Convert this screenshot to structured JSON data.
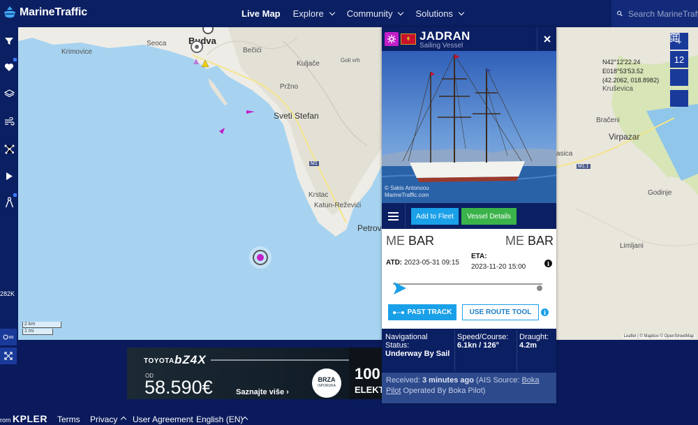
{
  "app": {
    "name": "MarineTraffic"
  },
  "nav": {
    "items": [
      {
        "label": "Live Map",
        "active": true,
        "dropdown": false
      },
      {
        "label": "Explore",
        "active": false,
        "dropdown": true
      },
      {
        "label": "Community",
        "active": false,
        "dropdown": true
      },
      {
        "label": "Solutions",
        "active": false,
        "dropdown": true
      }
    ]
  },
  "search": {
    "placeholder": "Search MarineTraffic"
  },
  "sidebar": {
    "items": [
      {
        "icon": "filter-icon",
        "locked": false
      },
      {
        "icon": "heart-icon",
        "locked": true
      },
      {
        "icon": "layers-icon",
        "locked": false
      },
      {
        "icon": "wind-icon",
        "locked": false
      },
      {
        "icon": "network-icon",
        "locked": false
      },
      {
        "icon": "play-icon",
        "locked": false
      },
      {
        "icon": "compass-icon",
        "locked": true
      }
    ],
    "count": "282K",
    "ops_label": "∞"
  },
  "map": {
    "places": [
      "Budva",
      "Seoca",
      "Krimovice",
      "Bečići",
      "Kuljače",
      "Goli vrh",
      "Pržno",
      "Sveti Stefan",
      "Krstac",
      "Katun-Reževići",
      "Petrov",
      "Kruševica",
      "Brаčeni",
      "Virpazar",
      "Godinje",
      "Limljani",
      "asica"
    ],
    "roads": [
      "M1",
      "M1.1"
    ],
    "coordinates": {
      "lat_dms": "N42°12'22.24",
      "lon_dms": "E018°53'53.52",
      "decimal": "(42.2062, 018.8982)"
    },
    "zoom_level": "12",
    "scale_km": "2 km",
    "scale_mi": "1 mi",
    "attribution": "Leaflet | © Mapbox © OpenStreetMap"
  },
  "vessel": {
    "name": "JADRAN",
    "type": "Sailing Vessel",
    "type_color": "#c21fc9",
    "photo_credit_line1": "© Sakis Antonoou",
    "photo_credit_line2": "MarineTraffic.com",
    "add_to_fleet_label": "Add to Fleet",
    "details_label": "Vessel Details",
    "departure": {
      "country": "ME",
      "port": "BAR"
    },
    "arrival": {
      "country": "ME",
      "port": "BAR"
    },
    "atd_label": "ATD:",
    "atd_value": "2023-05-31 09:15",
    "eta_label": "ETA:",
    "eta_value": "2023-11-20 15:00",
    "voyage_progress": 0,
    "past_track_label": "PAST TRACK",
    "route_tool_label": "USE ROUTE TOOL",
    "nav_status_label": "Navigational Status:",
    "nav_status_value": "Underway By Sail",
    "speed_label": "Speed/Course:",
    "speed_value": "6.1kn / 126°",
    "draught_label": "Draught:",
    "draught_value": "4.2m",
    "received_prefix": "Received:",
    "received_value": "3 minutes ago",
    "ais_source_prefix": "(AIS Source:",
    "ais_source_name": "Boka Pilot",
    "operated_by": "Operated By Boka Pilot)"
  },
  "ad": {
    "brand": "TOYOTA",
    "model": "bZ4X",
    "od_label": "OD",
    "price": "58.590€",
    "cta": "Saznajte više ›",
    "badge_line1": "BRZA",
    "badge_line2": "ISPORUKA",
    "right_text1": "100",
    "right_text2": "ELEKT"
  },
  "footer": {
    "from": "rom",
    "brand": "KPLER",
    "links": [
      "Terms",
      "Privacy",
      "User Agreement",
      "English (EN)"
    ]
  }
}
